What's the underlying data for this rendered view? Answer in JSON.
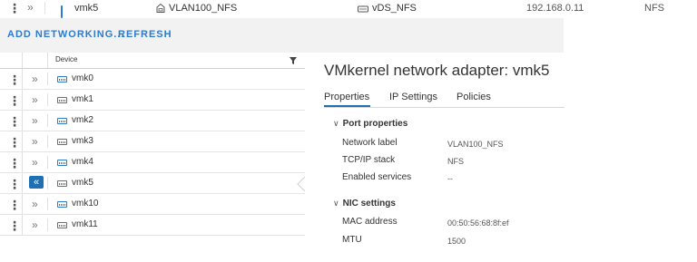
{
  "top_row": {
    "expand_icon": "double-chevron-right",
    "device": "vmk5",
    "network_label": "VLAN100_NFS",
    "switch": "vDS_NFS",
    "ip": "192.168.0.11",
    "stack": "NFS"
  },
  "toolbar": {
    "add_networking": "ADD NETWORKING...",
    "refresh": "REFRESH"
  },
  "grid": {
    "column_device": "Device",
    "filter_icon": "filter-icon",
    "rows": [
      {
        "device": "vmk0"
      },
      {
        "device": "vmk1"
      },
      {
        "device": "vmk2"
      },
      {
        "device": "vmk3"
      },
      {
        "device": "vmk4"
      },
      {
        "device": "vmk5",
        "selected": true
      },
      {
        "device": "vmk10"
      },
      {
        "device": "vmk11"
      }
    ]
  },
  "detail": {
    "title": "VMkernel network adapter: vmk5",
    "tabs": [
      "Properties",
      "IP Settings",
      "Policies"
    ],
    "active_tab": "Properties",
    "port_properties": {
      "heading": "Port properties",
      "network_label": {
        "label": "Network label",
        "value": "VLAN100_NFS"
      },
      "tcpip_stack": {
        "label": "TCP/IP stack",
        "value": "NFS"
      },
      "enabled_services": {
        "label": "Enabled services",
        "value": "--"
      }
    },
    "nic_settings": {
      "heading": "NIC settings",
      "mac_address": {
        "label": "MAC address",
        "value": "00:50:56:68:8f:ef"
      },
      "mtu": {
        "label": "MTU",
        "value": "1500"
      }
    }
  },
  "colors": {
    "accent": "#1f6fb5",
    "link": "#2b7bd1",
    "toolbar_bg": "#f2f2f2"
  }
}
